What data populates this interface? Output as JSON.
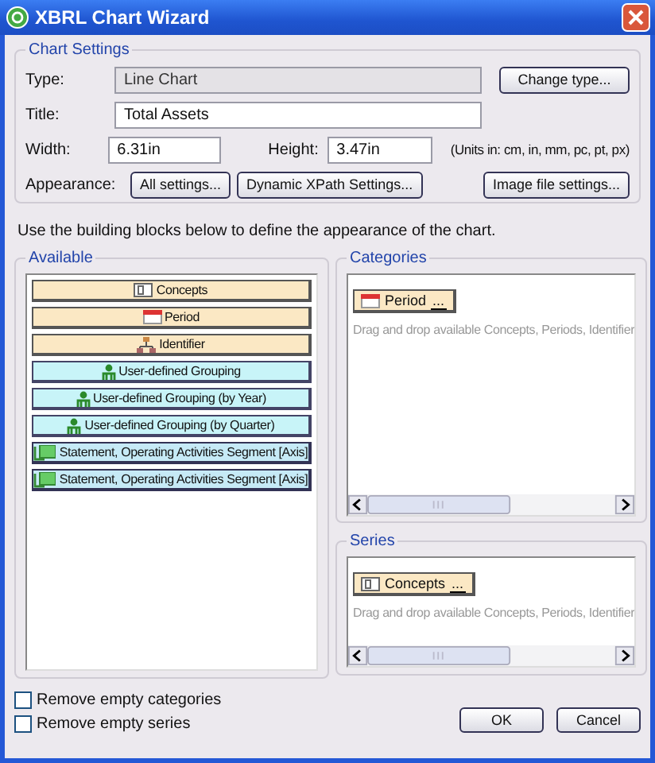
{
  "window": {
    "title": "XBRL Chart Wizard"
  },
  "chart_settings": {
    "legend": "Chart Settings",
    "type": {
      "label": "Type:",
      "value": "Line Chart",
      "disabled": true
    },
    "change_type_button": "Change type...",
    "title": {
      "label": "Title:",
      "value": "Total Assets"
    },
    "width": {
      "label": "Width:",
      "value": "6.31in"
    },
    "height": {
      "label": "Height:",
      "value": "3.47in"
    },
    "units_note": "(Units in: cm, in, mm, pc, pt, px)",
    "appearance_label": "Appearance:",
    "appearance_buttons": [
      "All settings...",
      "Dynamic XPath Settings..."
    ],
    "image_file_button": "Image file settings..."
  },
  "instructions": "Use the building blocks below to define the appearance of the chart.",
  "available": {
    "legend": "Available",
    "blocks": [
      {
        "label": "Concepts",
        "kind": "concept"
      },
      {
        "label": "Period",
        "kind": "period"
      },
      {
        "label": "Identifier",
        "kind": "identifier"
      },
      {
        "label": "User-defined Grouping",
        "kind": "grouping"
      },
      {
        "label": "User-defined Grouping (by Year)",
        "kind": "grouping"
      },
      {
        "label": "User-defined Grouping (by Quarter)",
        "kind": "grouping"
      },
      {
        "label": "Statement, Operating Activities Segment [Axis]",
        "kind": "axis"
      },
      {
        "label": "Statement, Operating Activities Segment [Axis]",
        "kind": "axis"
      }
    ]
  },
  "categories": {
    "legend": "Categories",
    "items": [
      {
        "label": "Period",
        "kind": "period",
        "menu": "..."
      }
    ],
    "hint": "Drag and drop available Concepts, Periods, Identifier"
  },
  "series": {
    "legend": "Series",
    "items": [
      {
        "label": "Concepts",
        "kind": "concept",
        "menu": "..."
      }
    ],
    "hint": "Drag and drop available Concepts, Periods, Identifier"
  },
  "options": [
    {
      "label": "Remove empty categories",
      "checked": false
    },
    {
      "label": "Remove empty series",
      "checked": false
    }
  ],
  "buttons": [
    "OK",
    "Cancel"
  ]
}
